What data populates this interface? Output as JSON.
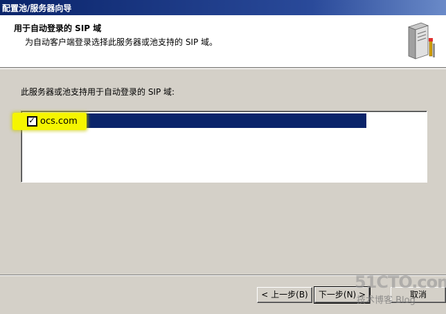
{
  "window": {
    "title": "配置池/服务器向导"
  },
  "header": {
    "title": "用于自动登录的 SIP 域",
    "subtitle": "为自动客户端登录选择此服务器或池支持的 SIP 域。",
    "icon": "server-tools-icon"
  },
  "main": {
    "prompt": "此服务器或池支持用于自动登录的 SIP 域:",
    "list_items": [
      {
        "label": "ocs.com",
        "checked": true
      }
    ]
  },
  "buttons": {
    "back": "< 上一步(B)",
    "next": "下一步(N) >",
    "cancel": "取消"
  },
  "watermark": {
    "site": "51CTO.com",
    "sub": "技术博客 Blog"
  },
  "colors": {
    "title_bar": "#0a246a",
    "selection": "#0a246a",
    "highlight": "#f5f500",
    "face": "#d4d0c8"
  }
}
